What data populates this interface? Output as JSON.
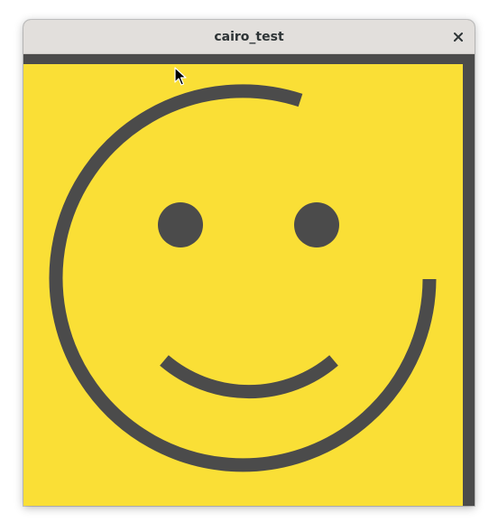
{
  "window": {
    "title": "cairo_test"
  },
  "colors": {
    "titlebar": "#e2dfdc",
    "title_text": "#2e3436",
    "canvas_background": "#fadf36",
    "drawing_stroke": "#4b4b4b",
    "window_background": "#4b4b4b"
  },
  "icons": {
    "close": "close-icon",
    "pointer": "mouse-pointer-icon"
  }
}
